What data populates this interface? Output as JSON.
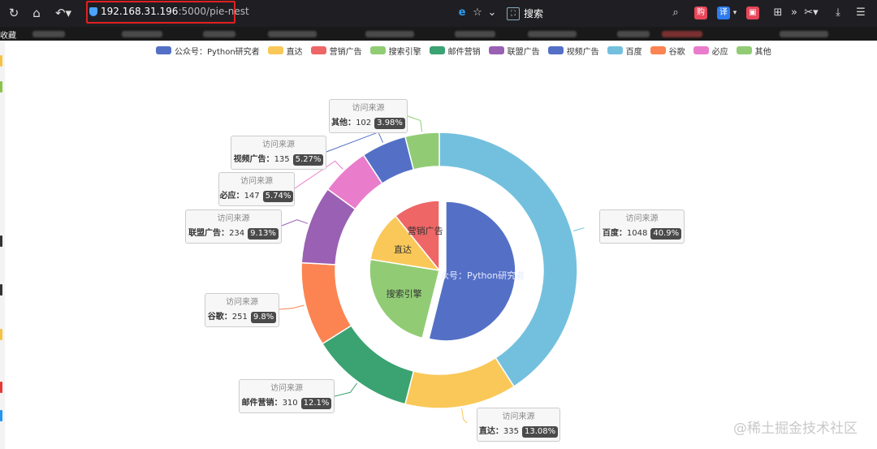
{
  "browser": {
    "url_host": "192.168.31.196",
    "url_path": ":5000/pie-nest",
    "search_placeholder": "搜索",
    "app_icons": [
      {
        "name": "shopping-icon",
        "text": "购",
        "color": "#e8465a"
      },
      {
        "name": "translate-icon",
        "text": "译",
        "color": "#2d7cf0"
      },
      {
        "name": "game-icon",
        "text": "🎮",
        "color": "#e8465a"
      }
    ],
    "bookmarks_label": "收藏"
  },
  "legend": [
    {
      "name": "公众号：Python研究者",
      "color": "#5470c6"
    },
    {
      "name": "直达",
      "color": "#fac858"
    },
    {
      "name": "营销广告",
      "color": "#ee6666"
    },
    {
      "name": "搜索引擎",
      "color": "#91cc75"
    },
    {
      "name": "邮件营销",
      "color": "#3ba272"
    },
    {
      "name": "联盟广告",
      "color": "#9a60b4"
    },
    {
      "name": "视频广告",
      "color": "#5470c6"
    },
    {
      "name": "百度",
      "color": "#73c0de"
    },
    {
      "name": "谷歌",
      "color": "#fc8452"
    },
    {
      "name": "必应",
      "color": "#ea7ccc"
    },
    {
      "name": "其他",
      "color": "#91cc75"
    }
  ],
  "chart_data": {
    "type": "pie",
    "inner": [
      {
        "name": "公众号：Python研究者",
        "value": 1548,
        "color": "#5470c6",
        "selected": true
      },
      {
        "name": "搜索引擎",
        "value": 679,
        "color": "#91cc75"
      },
      {
        "name": "直达",
        "value": 335,
        "color": "#fac858"
      },
      {
        "name": "营销广告",
        "value": 310,
        "color": "#ee6666"
      }
    ],
    "outer": [
      {
        "name": "百度",
        "value": 1048,
        "percent": "40.9%",
        "color": "#73c0de"
      },
      {
        "name": "直达",
        "value": 335,
        "percent": "13.08%",
        "color": "#fac858"
      },
      {
        "name": "邮件营销",
        "value": 310,
        "percent": "12.1%",
        "color": "#3ba272"
      },
      {
        "name": "谷歌",
        "value": 251,
        "percent": "9.8%",
        "color": "#fc8452"
      },
      {
        "name": "联盟广告",
        "value": 234,
        "percent": "9.13%",
        "color": "#9a60b4"
      },
      {
        "name": "必应",
        "value": 147,
        "percent": "5.74%",
        "color": "#ea7ccc"
      },
      {
        "name": "视频广告",
        "value": 135,
        "percent": "5.27%",
        "color": "#5470c6"
      },
      {
        "name": "其他",
        "value": 102,
        "percent": "3.98%",
        "color": "#91cc75"
      }
    ],
    "label_title": "访问来源"
  },
  "watermark": "@稀土掘金技术社区"
}
